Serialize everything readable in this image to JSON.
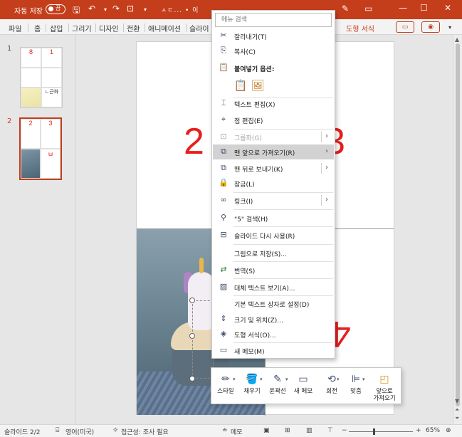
{
  "titlebar": {
    "autosave_label": "자동 저장",
    "toggle_state": "끔",
    "doc_title": "ㅅㄷ... • 이",
    "icons": [
      "save-icon",
      "undo-icon",
      "redo-icon",
      "present-icon",
      "customize-icon"
    ]
  },
  "ribbon": {
    "tabs": [
      "파일",
      "홈",
      "삽입",
      "그리기",
      "디자인",
      "전환",
      "애니메이션",
      "슬라이"
    ],
    "context_tab": "도형 서식"
  },
  "thumbnails": {
    "slides": [
      {
        "number": "1",
        "cells": [
          "8",
          "1",
          "",
          "",
          "",
          "ㄴ근화"
        ]
      },
      {
        "number": "2",
        "cells": [
          "2",
          "3",
          "",
          "ㅂ"
        ]
      }
    ]
  },
  "slide": {
    "numbers": {
      "left": "2",
      "right": "3",
      "bottom": "4"
    }
  },
  "context_menu": {
    "search_placeholder": "메뉴 검색",
    "items": {
      "cut": "잘라내기(T)",
      "copy": "복사(C)",
      "paste_options": "붙여넣기 옵션:",
      "edit_text": "텍스트 편집(X)",
      "edit_points": "점 편집(E)",
      "group": "그룹화(G)",
      "bring_front": "맨 앞으로 가져오기(R)",
      "send_back": "맨 뒤로 보내기(K)",
      "lock": "잠금(L)",
      "link": "링크(I)",
      "search": "\"5\" 검색(H)",
      "reuse": "슬라이드 다시 사용(R)",
      "save_picture": "그림으로 저장(S)...",
      "translate": "번역(S)",
      "alt_text": "대체 텍스트 보기(A)...",
      "default_textbox": "기본 텍스트 상자로 설정(D)",
      "size_position": "크기 및 위치(Z)...",
      "format_shape": "도형 서식(O)...",
      "new_comment": "새 메모(M)"
    }
  },
  "mini_toolbar": {
    "style": "스타일",
    "fill": "채우기",
    "outline": "윤곽선",
    "new_comment": "새 메모",
    "rotate": "회전",
    "align": "맞춤",
    "bring_front_line1": "앞으로",
    "bring_front_line2": "가져오기"
  },
  "status": {
    "slide_info": "슬라이드 2/2",
    "language": "영어(미국)",
    "accessibility": "접근성: 조사 필요",
    "notes": "메모",
    "zoom": "65%"
  },
  "colors": {
    "accent": "#c43e1c",
    "slide_number": "#e81e1e"
  }
}
